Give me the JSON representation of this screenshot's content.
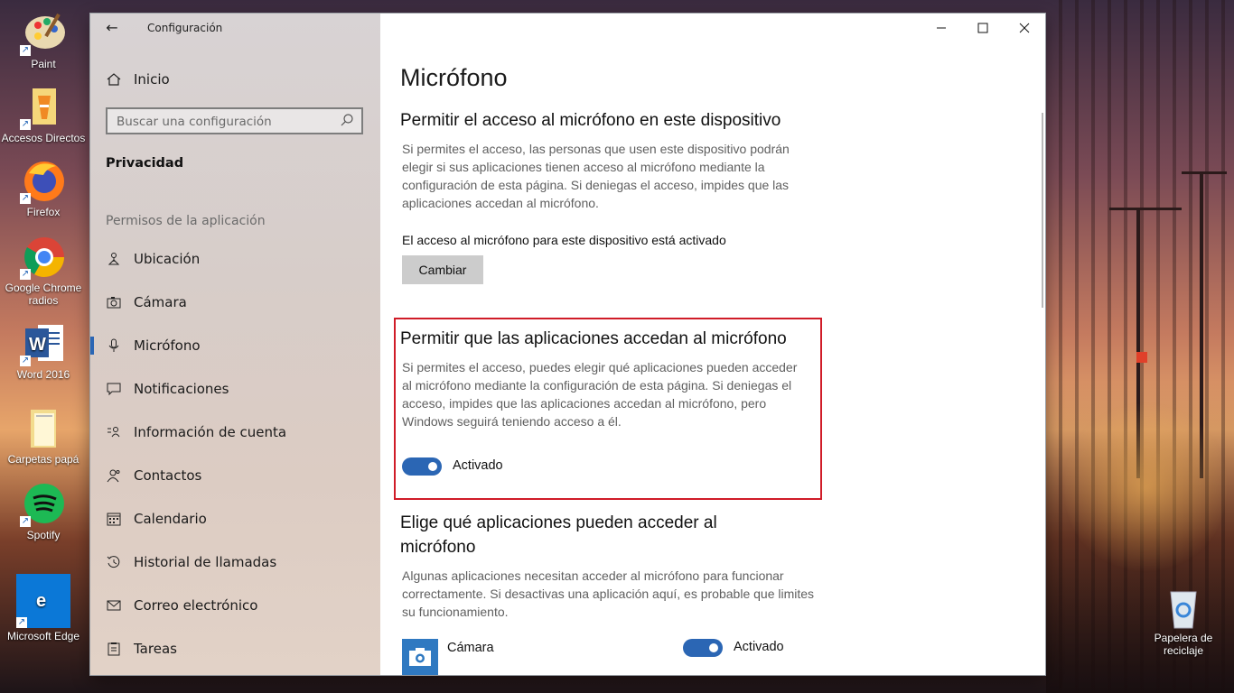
{
  "desktop": {
    "icons": [
      {
        "label": "Paint"
      },
      {
        "label": "Accesos Directos"
      },
      {
        "label": "Firefox"
      },
      {
        "label": "Google Chrome radios"
      },
      {
        "label": "Word 2016"
      },
      {
        "label": "Carpetas papá"
      },
      {
        "label": "Spotify"
      },
      {
        "label": "Microsoft Edge"
      }
    ],
    "recycle_bin": {
      "label": "Papelera de reciclaje"
    }
  },
  "window": {
    "title": "Configuración",
    "controls": {
      "minimize": "—",
      "maximize": "☐",
      "close": "✕"
    }
  },
  "sidebar": {
    "home_label": "Inicio",
    "search_placeholder": "Buscar una configuración",
    "section_title": "Privacidad",
    "group_label": "Permisos de la aplicación",
    "items": [
      {
        "label": "Ubicación",
        "icon": "location-icon"
      },
      {
        "label": "Cámara",
        "icon": "camera-icon"
      },
      {
        "label": "Micrófono",
        "icon": "microphone-icon",
        "active": true
      },
      {
        "label": "Notificaciones",
        "icon": "notification-icon"
      },
      {
        "label": "Información de cuenta",
        "icon": "account-info-icon"
      },
      {
        "label": "Contactos",
        "icon": "contacts-icon"
      },
      {
        "label": "Calendario",
        "icon": "calendar-icon"
      },
      {
        "label": "Historial de llamadas",
        "icon": "call-history-icon"
      },
      {
        "label": "Correo electrónico",
        "icon": "mail-icon"
      },
      {
        "label": "Tareas",
        "icon": "tasks-icon"
      }
    ]
  },
  "main": {
    "page_title": "Micrófono",
    "device_section": {
      "heading": "Permitir el acceso al micrófono en este dispositivo",
      "description": "Si permites el acceso, las personas que usen este dispositivo podrán elegir si sus aplicaciones tienen acceso al micrófono mediante la configuración de esta página. Si deniegas el acceso, impides que las aplicaciones accedan al micrófono.",
      "status": "El acceso al micrófono para este dispositivo está activado",
      "button_label": "Cambiar"
    },
    "apps_section": {
      "heading": "Permitir que las aplicaciones accedan al micrófono",
      "description": "Si permites el acceso, puedes elegir qué aplicaciones pueden acceder al micrófono mediante la configuración de esta página. Si deniegas el acceso, impides que las aplicaciones accedan al micrófono, pero Windows seguirá teniendo acceso a él.",
      "toggle_label": "Activado",
      "toggle_on": true
    },
    "choose_section": {
      "heading_line1": "Elige qué aplicaciones pueden acceder al",
      "heading_line2": "micrófono",
      "description": "Algunas aplicaciones necesitan acceder al micrófono para funcionar correctamente. Si desactivas una aplicación aquí, es probable que limites su funcionamiento.",
      "apps": [
        {
          "name": "Cámara",
          "toggle_label": "Activado",
          "toggle_on": true
        }
      ]
    }
  },
  "colors": {
    "accent": "#2b66b4",
    "highlight": "#d01c28"
  }
}
